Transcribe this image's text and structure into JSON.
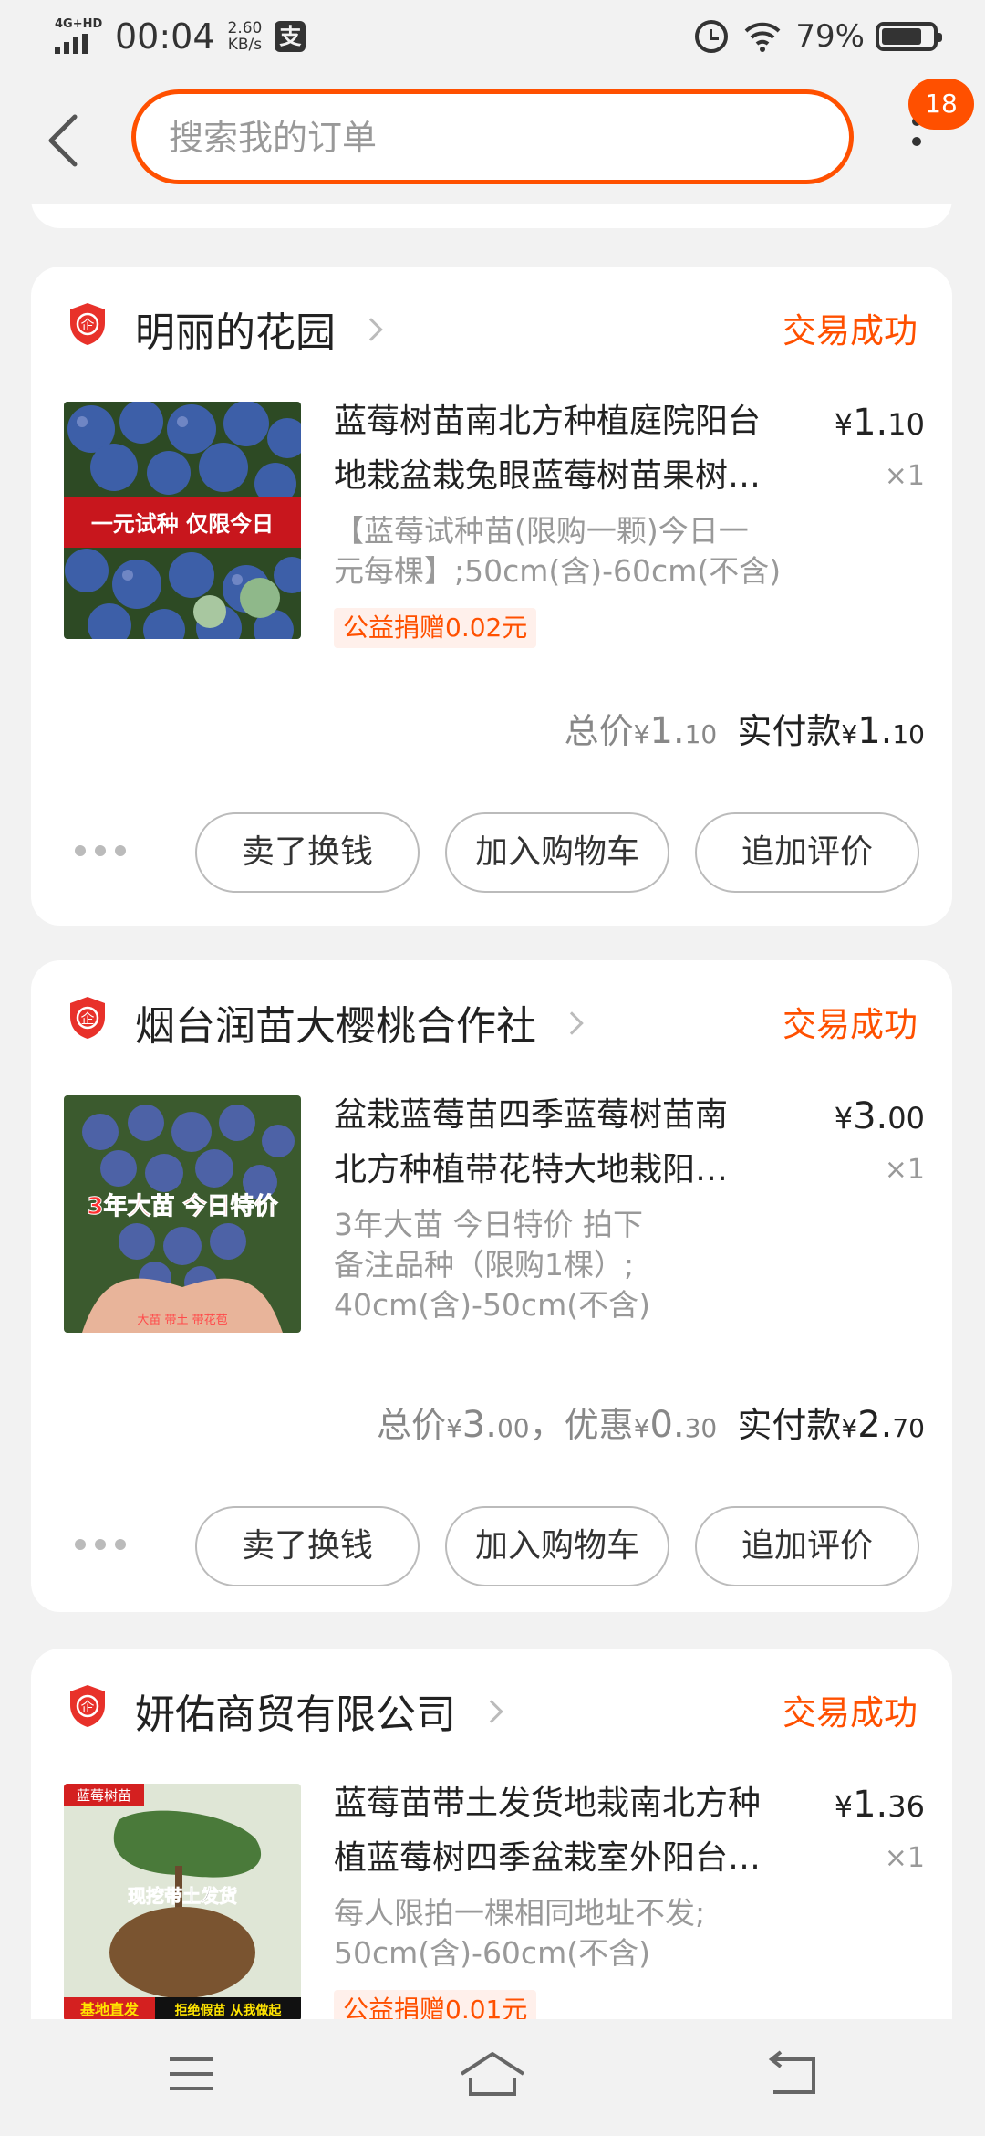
{
  "status_bar": {
    "network": "4G+HD",
    "time": "00:04",
    "speed_value": "2.60",
    "speed_unit": "KB/s",
    "pay_icon": "支",
    "battery_percent": "79%",
    "battery_level": 0.79
  },
  "header": {
    "search_placeholder": "搜索我的订单",
    "badge_count": "18"
  },
  "orders": [
    {
      "shop_name": "明丽的花园",
      "status": "交易成功",
      "product_title_line1": "蓝莓树苗南北方种植庭院阳台",
      "product_title_line2": "地栽盆栽兔眼蓝莓树苗果树…",
      "sku_line1": "【蓝莓试种苗(限购一颗)今日一",
      "sku_line2": "元每棵】;50cm(含)-60cm(不含)",
      "donation": "公益捐赠0.02元",
      "price_yen": "¥",
      "price_int": "1.",
      "price_dec": "10",
      "qty": "×1",
      "total_label": "总价",
      "total_yen": "¥",
      "total_int": "1.",
      "total_dec": "10",
      "paid_label": "实付款",
      "paid_yen": "¥",
      "paid_int": "1.",
      "paid_dec": "10",
      "image_banner": "一元试种  仅限今日",
      "actions": [
        "卖了换钱",
        "加入购物车",
        "追加评价"
      ]
    },
    {
      "shop_name": "烟台润苗大樱桃合作社",
      "status": "交易成功",
      "product_title_line1": "盆栽蓝莓苗四季蓝莓树苗南",
      "product_title_line2": "北方种植带花特大地栽阳…",
      "sku_line1": "3年大苗 今日特价 拍下",
      "sku_line2": "备注品种（限购1棵）;",
      "sku_line3": "40cm(含)-50cm(不含)",
      "price_yen": "¥",
      "price_int": "3.",
      "price_dec": "00",
      "qty": "×1",
      "total_label": "总价",
      "total_yen": "¥",
      "total_int": "3.",
      "total_dec": "00",
      "discount_label": "，优惠",
      "discount_yen": "¥",
      "discount_int": "0.",
      "discount_dec": "30",
      "paid_label": "实付款",
      "paid_yen": "¥",
      "paid_int": "2.",
      "paid_dec": "70",
      "image_banner": "3年大苗  今日特价",
      "image_caption": "大苗  带土  带花苞",
      "actions": [
        "卖了换钱",
        "加入购物车",
        "追加评价"
      ]
    },
    {
      "shop_name": "妍佑商贸有限公司",
      "status": "交易成功",
      "product_title_line1": "蓝莓苗带土发货地栽南北方种",
      "product_title_line2": "植蓝莓树四季盆栽室外阳台…",
      "sku_line1": "每人限拍一棵相同地址不发;",
      "sku_line2": "50cm(含)-60cm(不含)",
      "donation": "公益捐赠0.01元",
      "price_yen": "¥",
      "price_int": "1.",
      "price_dec": "36",
      "qty": "×1",
      "image_tag": "蓝莓树苗",
      "image_mid": "现挖带土发货",
      "image_bottom_left": "基地直发",
      "image_bottom_right": "拒绝假苗 从我做起"
    }
  ],
  "colors": {
    "accent": "#ff5000",
    "background": "#f2f2f2",
    "card": "#ffffff",
    "muted_text": "#999999"
  },
  "icons": {
    "back": "back-arrow-icon",
    "more": "more-vertical-icon",
    "shop_badge": "enterprise-shield-icon",
    "nav_menu": "menu-icon",
    "nav_home": "home-icon",
    "nav_back": "back-icon"
  }
}
